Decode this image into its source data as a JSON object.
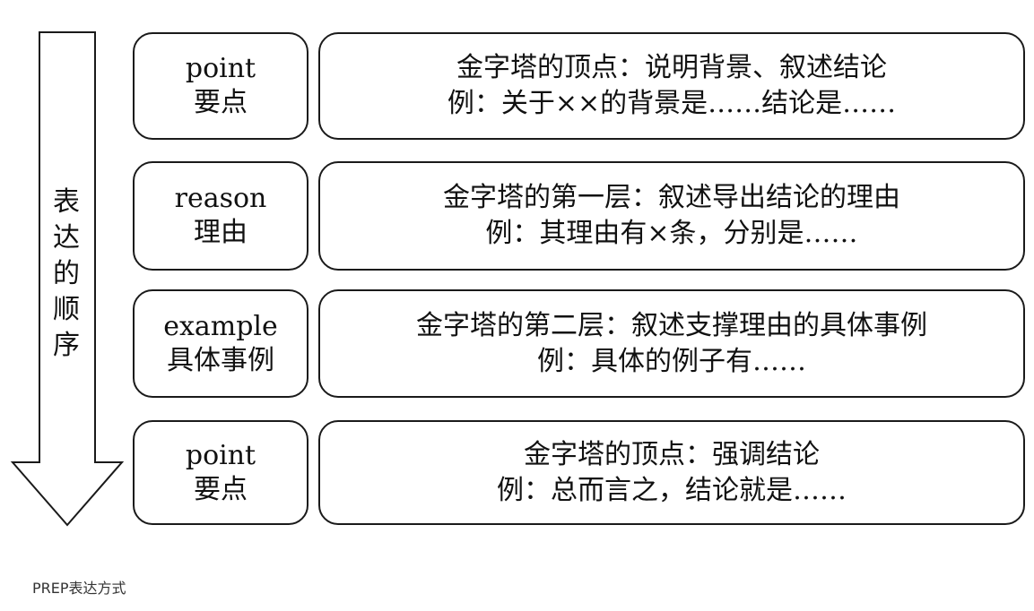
{
  "arrow_label": [
    "表",
    "达",
    "的",
    "顺",
    "序"
  ],
  "rows": [
    {
      "label_en": "point",
      "label_zh": "要点",
      "line1": "金字塔的顶点：说明背景、叙述结论",
      "line2": "例：关于××的背景是……结论是……"
    },
    {
      "label_en": "reason",
      "label_zh": "理由",
      "line1": "金字塔的第一层：叙述导出结论的理由",
      "line2": "例：其理由有×条，分别是……"
    },
    {
      "label_en": "example",
      "label_zh": "具体事例",
      "line1": "金字塔的第二层：叙述支撑理由的具体事例",
      "line2": "例：具体的例子有……"
    },
    {
      "label_en": "point",
      "label_zh": "要点",
      "line1": "金字塔的顶点：强调结论",
      "line2": "例：总而言之，结论就是……"
    }
  ],
  "caption": "PREP表达方式"
}
